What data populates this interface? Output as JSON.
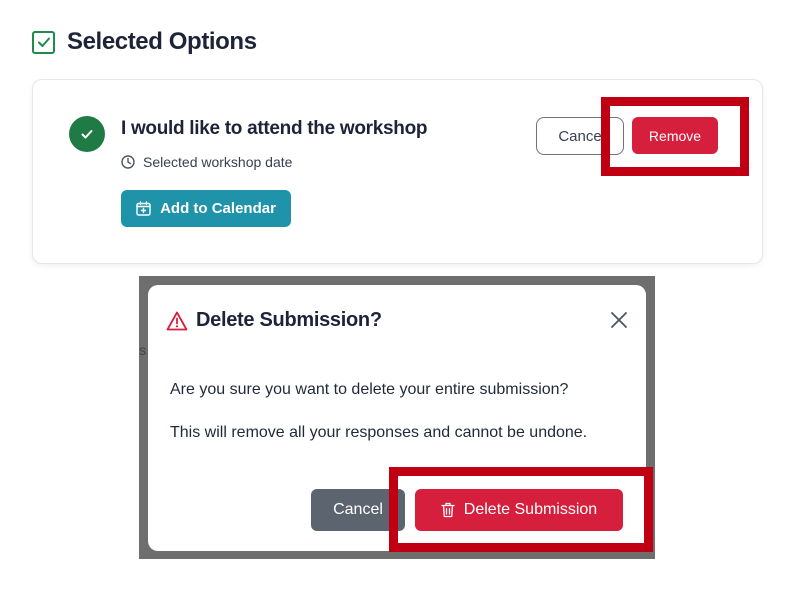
{
  "header": {
    "title": "Selected Options",
    "check_icon": "checkbox-checked-icon"
  },
  "option": {
    "title": "I would like to attend the workshop",
    "date_label": "Selected workshop date",
    "add_calendar_label": "Add to Calendar",
    "cancel_label": "Cance",
    "remove_label": "Remove",
    "icons": [
      "check-circle-icon",
      "clock-icon",
      "calendar-plus-icon"
    ]
  },
  "modal": {
    "title": "Delete Submission?",
    "question": "Are you sure you want to delete your entire submission?",
    "note": "This will remove all your responses and cannot be undone.",
    "cancel_label": "Cancel",
    "delete_label": "Delete Submission",
    "icons": [
      "warning-triangle-icon",
      "close-icon",
      "trash-icon"
    ],
    "background_fragment": "ss"
  },
  "colors": {
    "brand_green": "#1f7a46",
    "accent_teal": "#1f93a9",
    "danger_red": "#d61f3c",
    "highlight_red": "#c00012",
    "neutral_gray": "#5c6470"
  }
}
